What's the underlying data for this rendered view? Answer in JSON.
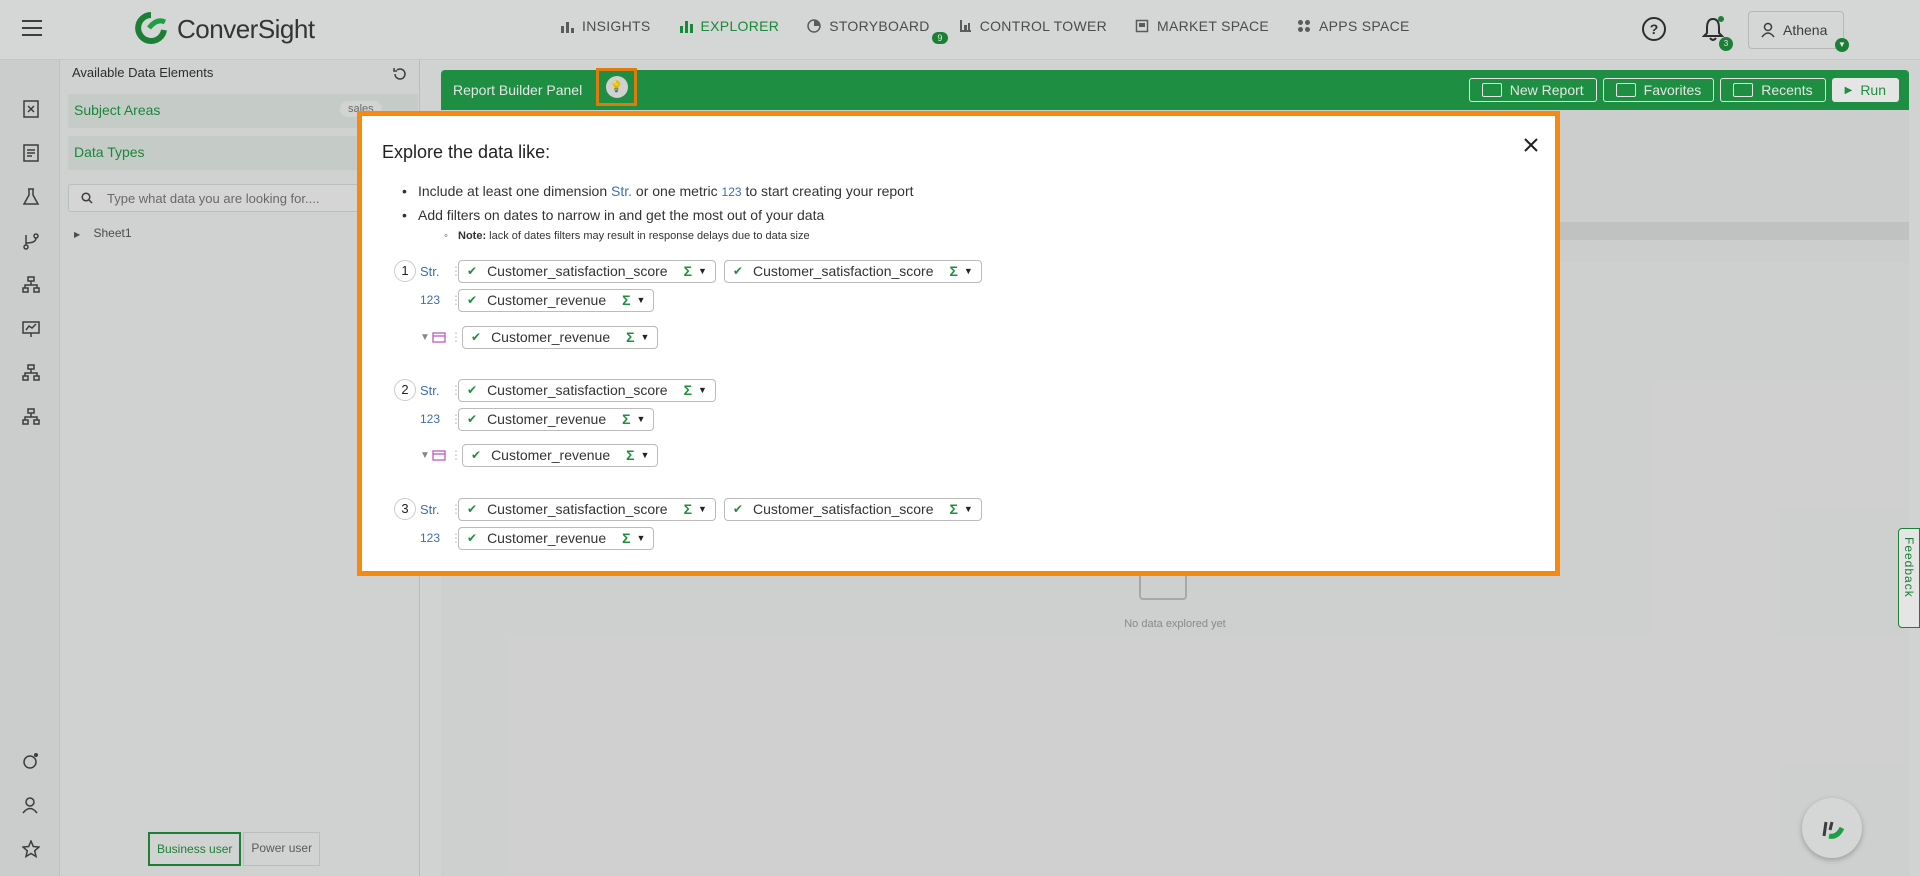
{
  "header": {
    "logo_text": "ConverSight",
    "nav": [
      {
        "label": "INSIGHTS",
        "icon": "bar-chart-icon"
      },
      {
        "label": "EXPLORER",
        "icon": "explorer-chart-icon",
        "active": true
      },
      {
        "label": "STORYBOARD",
        "icon": "storyboard-icon",
        "badge": "9"
      },
      {
        "label": "CONTROL TOWER",
        "icon": "control-tower-icon"
      },
      {
        "label": "MARKET SPACE",
        "icon": "market-space-icon"
      },
      {
        "label": "APPS SPACE",
        "icon": "apps-grid-icon"
      }
    ],
    "notifications_count": "3",
    "user_name": "Athena"
  },
  "left_panel": {
    "title": "Available Data Elements",
    "subject_areas_label": "Subject Areas",
    "subject_area_pill": "sales",
    "data_types_label": "Data Types",
    "search_placeholder": "Type what data you are looking for....",
    "tree_item": "Sheet1",
    "mode_business": "Business user",
    "mode_power": "Power user"
  },
  "report": {
    "title": "Report Builder Panel",
    "actions": {
      "new_report": "New Report",
      "favorites": "Favorites",
      "recents": "Recents",
      "run": "Run"
    },
    "empty_text": "No data explored yet"
  },
  "feedback_label": "Feedback",
  "modal": {
    "title": "Explore the data like:",
    "tip1_pre": "Include at least one dimension",
    "tip1_str": "Str.",
    "tip1_mid": "or one metric",
    "tip1_num": "123",
    "tip1_post": "to start creating your report",
    "tip2": "Add filters on dates to narrow in and get the most out of your data",
    "note_label": "Note:",
    "note_text": "lack of dates filters may result in response delays due to data size",
    "str_label": "Str.",
    "num_label": "123",
    "examples": [
      {
        "num": "1",
        "str_chips": [
          "Customer_satisfaction_score",
          "Customer_satisfaction_score"
        ],
        "num_chips": [
          "Customer_revenue"
        ],
        "filter_chips": [
          "Customer_revenue"
        ]
      },
      {
        "num": "2",
        "str_chips": [
          "Customer_satisfaction_score"
        ],
        "num_chips": [
          "Customer_revenue"
        ],
        "filter_chips": [
          "Customer_revenue"
        ]
      },
      {
        "num": "3",
        "str_chips": [
          "Customer_satisfaction_score",
          "Customer_satisfaction_score"
        ],
        "num_chips": [
          "Customer_revenue"
        ],
        "filter_chips": []
      }
    ],
    "sigma": "Σ"
  }
}
